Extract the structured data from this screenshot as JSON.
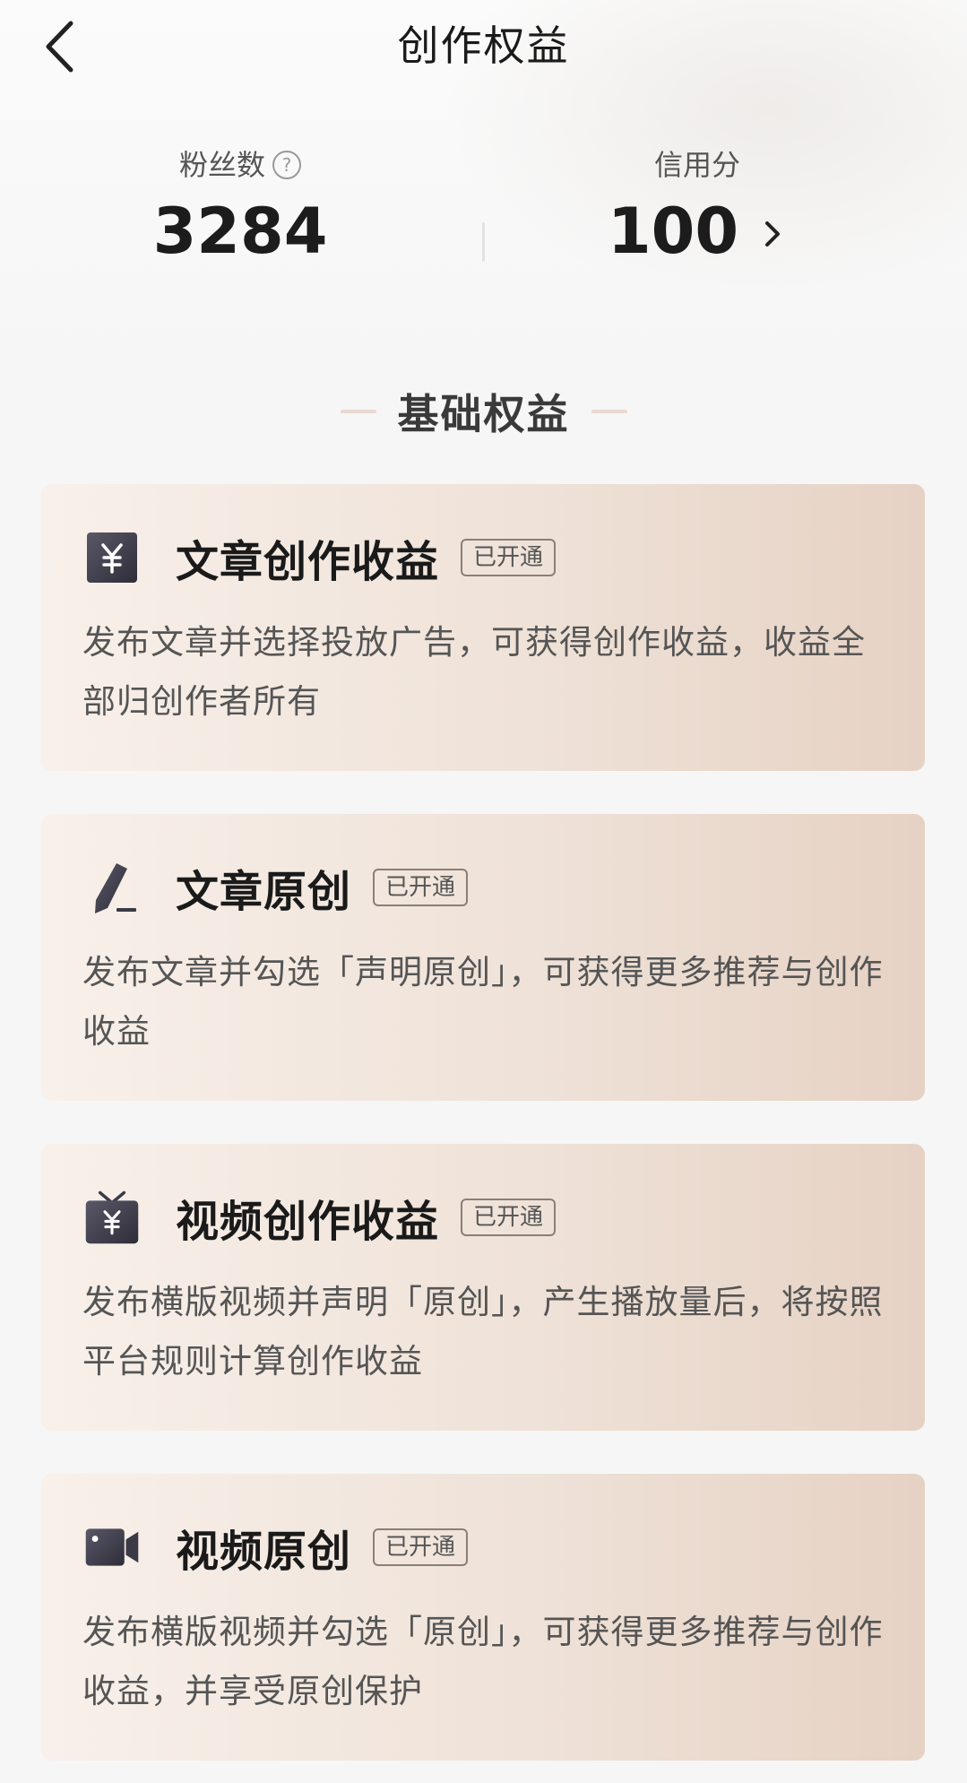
{
  "header": {
    "title": "创作权益"
  },
  "stats": {
    "fans": {
      "label": "粉丝数",
      "value": "3284"
    },
    "credit": {
      "label": "信用分",
      "value": "100"
    }
  },
  "section": {
    "title": "基础权益"
  },
  "cards": [
    {
      "icon": "yuan-icon",
      "title": "文章创作收益",
      "badge": "已开通",
      "desc": "发布文章并选择投放广告，可获得创作收益，收益全部归创作者所有"
    },
    {
      "icon": "pen-icon",
      "title": "文章原创",
      "badge": "已开通",
      "desc": "发布文章并勾选「声明原创」，可获得更多推荐与创作收益"
    },
    {
      "icon": "tv-yuan-icon",
      "title": "视频创作收益",
      "badge": "已开通",
      "desc": "发布横版视频并声明「原创」，产生播放量后，将按照平台规则计算创作收益"
    },
    {
      "icon": "video-camera-icon",
      "title": "视频原创",
      "badge": "已开通",
      "desc": "发布横版视频并勾选「原创」，可获得更多推荐与创作收益，并享受原创保护"
    }
  ],
  "colors": {
    "card_gradient_start": "#f8f0ea",
    "card_gradient_end": "#e6d2c4",
    "icon": "#3a3a46"
  }
}
